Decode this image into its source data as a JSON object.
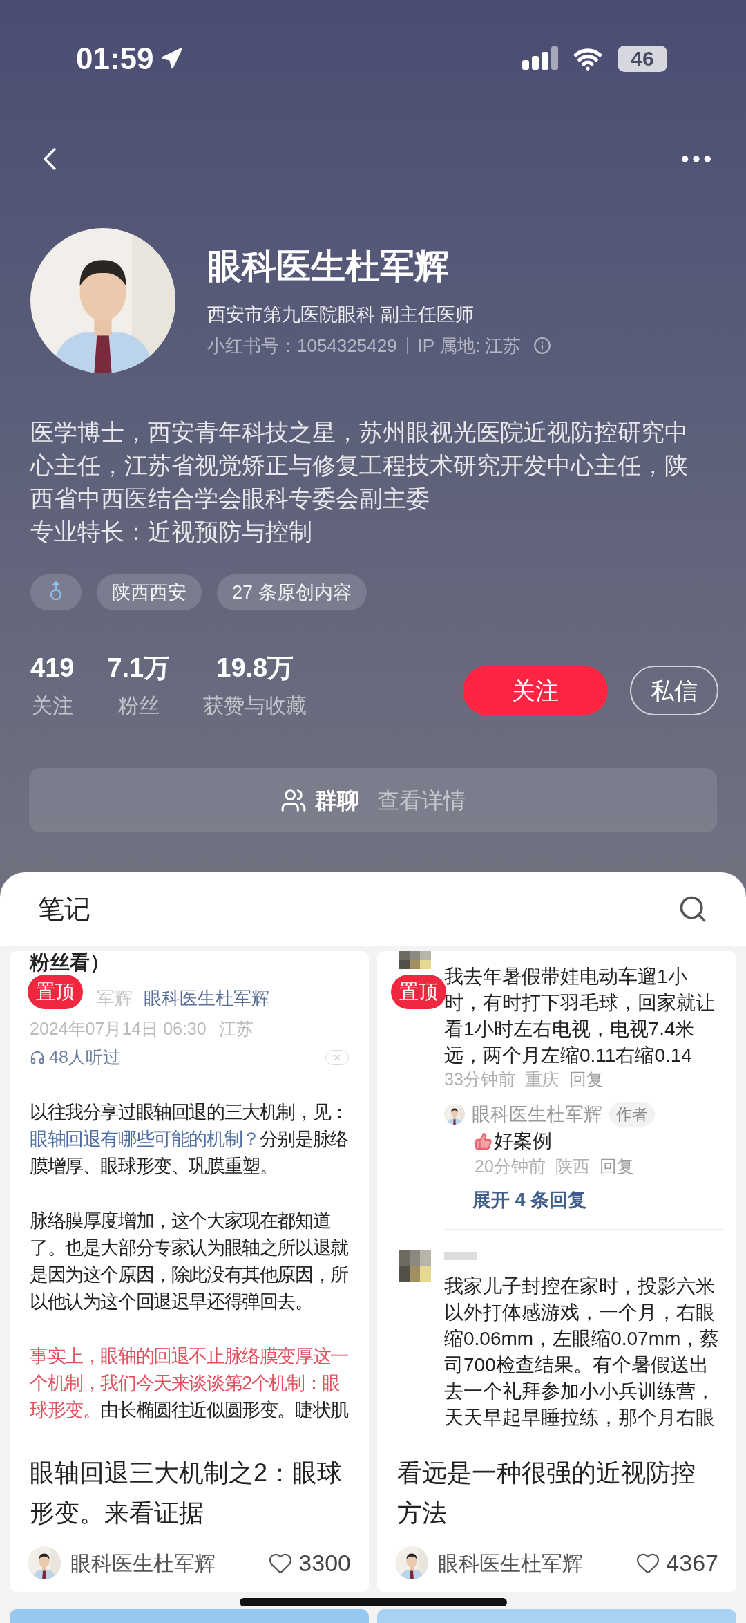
{
  "status_bar": {
    "time": "01:59",
    "battery": "46"
  },
  "profile": {
    "name": "眼科医生杜军辉",
    "position": "西安市第九医院眼科 副主任医师",
    "account_id": "小红书号：1054325429",
    "ip_location": "IP 属地: 江苏",
    "bio": [
      "医学博士，西安青年科技之星，苏州眼视光医院近视防控研究中心主任，江苏省视觉矫正与修复工程技术研究开发中心主任，陕西省中西医结合学会眼科专委会副主委",
      "专业特长：近视预防与控制"
    ],
    "tags": [
      {
        "kind": "gender"
      },
      {
        "kind": "text",
        "label": "陕西西安"
      },
      {
        "kind": "text",
        "label": "27 条原创内容"
      }
    ],
    "stats": [
      {
        "value": "419",
        "label": "关注"
      },
      {
        "value": "7.1万",
        "label": "粉丝"
      },
      {
        "value": "19.8万",
        "label": "获赞与收藏"
      }
    ],
    "follow_button": "关注",
    "message_button": "私信",
    "group_chat": {
      "label": "群聊",
      "action": "查看详情"
    }
  },
  "section_title": "笔记",
  "notes": [
    {
      "kind": "article",
      "pinned": true,
      "pin_label": "置顶",
      "heading": "粉丝看）",
      "byline_cut": "军辉",
      "byline": "眼科医生杜军辉",
      "date": "2024年07月14日 06:30",
      "location": "江苏",
      "listens": "48人听过",
      "paragraphs": [
        [
          {
            "kind": "plain",
            "text": "以往我分享过眼轴回退的三大机制，见："
          },
          {
            "kind": "link",
            "text": "眼轴回退有哪些可能的机制？"
          },
          {
            "kind": "plain",
            "text": "分别是脉络膜增厚、眼球形变、巩膜重塑。"
          }
        ],
        [
          {
            "kind": "plain",
            "text": "脉络膜厚度增加，这个大家现在都知道了。也是大部分专家认为眼轴之所以退就是因为这个原因，除此没有其他原因，所以他认为这个回退迟早还得弹回去。"
          }
        ],
        [
          {
            "kind": "emphasis",
            "text": "事实上，眼轴的回退不止脉络膜变厚这一个机制，我们今天来谈谈第2个机制：眼球形变。"
          },
          {
            "kind": "plain",
            "text": "由长椭圆往近似圆形变。睫状肌"
          }
        ]
      ],
      "title": "眼轴回退三大机制之2：眼球形变。来看证据",
      "author": "眼科医生杜军辉",
      "likes": "3300"
    },
    {
      "kind": "comments",
      "pinned": true,
      "pin_label": "置顶",
      "comments": [
        {
          "text": "我去年暑假带娃电动车遛1小时，有时打下羽毛球，回家就让看1小时左右电视，电视7.4米远，两个月左缩0.11右缩0.14",
          "time": "33分钟前",
          "location": "重庆",
          "reply": "回复",
          "replies": [
            {
              "author": "眼科医生杜军辉",
              "badge": "作者",
              "text": "好案例",
              "time": "20分钟前",
              "location": "陕西",
              "reply": "回复"
            }
          ],
          "expand": "展开 4 条回复"
        },
        {
          "text": "我家儿子封控在家时，投影六米以外打体感游戏，一个月，右眼缩0.06mm，左眼缩0.07mm，蔡司700检查结果。有个暑假送出去一个礼拜参加小小兵训练营，天天早起早睡拉练，那个月右眼"
        }
      ],
      "title": "看远是一种很强的近视防控方法",
      "author": "眼科医生杜军辉",
      "likes": "4367"
    }
  ]
}
